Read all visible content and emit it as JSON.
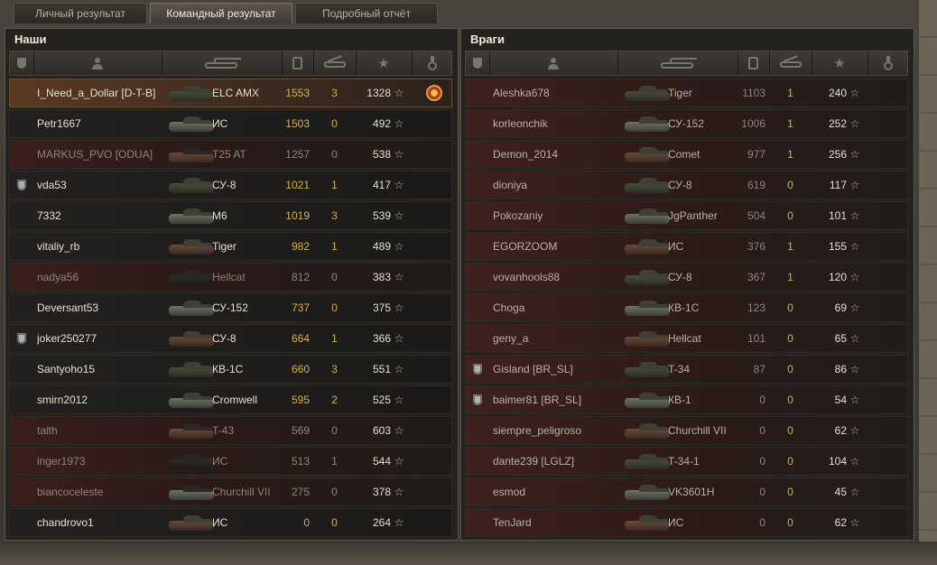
{
  "tabs": [
    {
      "label": "Личный результат",
      "active": false
    },
    {
      "label": "Командный результат",
      "active": true
    },
    {
      "label": "Подробный отчёт",
      "active": false
    }
  ],
  "ours": {
    "title": "Наши",
    "header_icons": [
      "shield-icon",
      "person-icon",
      "tank-icon",
      "hp-icon",
      "destroyed-icon",
      "star-icon",
      "medal-icon"
    ],
    "rows": [
      {
        "badge": false,
        "name": "I_Need_a_Dollar [D-T-B]",
        "tank": "ELC AMX",
        "damage": "1553",
        "kills": "3",
        "xp": "1328",
        "star": "☆",
        "medal": true,
        "alive": true,
        "self": true
      },
      {
        "badge": false,
        "name": "Petr1667",
        "tank": "ИС",
        "damage": "1503",
        "kills": "0",
        "xp": "492",
        "star": "☆",
        "medal": false,
        "alive": true
      },
      {
        "badge": false,
        "name": "MARKUS_PVO [ODUA]",
        "tank": "T25 AT",
        "damage": "1257",
        "kills": "0",
        "xp": "538",
        "star": "☆",
        "medal": false,
        "alive": false
      },
      {
        "badge": true,
        "name": "vda53",
        "tank": "СУ-8",
        "damage": "1021",
        "kills": "1",
        "xp": "417",
        "star": "☆",
        "medal": false,
        "alive": true
      },
      {
        "badge": false,
        "name": "7332",
        "tank": "M6",
        "damage": "1019",
        "kills": "3",
        "xp": "539",
        "star": "☆",
        "medal": false,
        "alive": true
      },
      {
        "badge": false,
        "name": "vitaliy_rb",
        "tank": "Tiger",
        "damage": "982",
        "kills": "1",
        "xp": "489",
        "star": "☆",
        "medal": false,
        "alive": true
      },
      {
        "badge": false,
        "name": "nadya56",
        "tank": "Hellcat",
        "damage": "812",
        "kills": "0",
        "xp": "383",
        "star": "☆",
        "medal": false,
        "alive": false
      },
      {
        "badge": false,
        "name": "Deversant53",
        "tank": "СУ-152",
        "damage": "737",
        "kills": "0",
        "xp": "375",
        "star": "☆",
        "medal": false,
        "alive": true
      },
      {
        "badge": true,
        "name": "joker250277",
        "tank": "СУ-8",
        "damage": "664",
        "kills": "1",
        "xp": "366",
        "star": "☆",
        "medal": false,
        "alive": true
      },
      {
        "badge": false,
        "name": "Santyoho15",
        "tank": "КВ-1С",
        "damage": "660",
        "kills": "3",
        "xp": "551",
        "star": "☆",
        "medal": false,
        "alive": true
      },
      {
        "badge": false,
        "name": "smirn2012",
        "tank": "Cromwell",
        "damage": "595",
        "kills": "2",
        "xp": "525",
        "star": "☆",
        "medal": false,
        "alive": true
      },
      {
        "badge": false,
        "name": "taith",
        "tank": "T-43",
        "damage": "569",
        "kills": "0",
        "xp": "603",
        "star": "☆",
        "medal": false,
        "alive": false
      },
      {
        "badge": false,
        "name": "inger1973",
        "tank": "ИС",
        "damage": "513",
        "kills": "1",
        "xp": "544",
        "star": "☆",
        "medal": false,
        "alive": false
      },
      {
        "badge": false,
        "name": "biancoceleste",
        "tank": "Churchill VII",
        "damage": "275",
        "kills": "0",
        "xp": "378",
        "star": "☆",
        "medal": false,
        "alive": false
      },
      {
        "badge": false,
        "name": "chandrovo1",
        "tank": "ИС",
        "damage": "0",
        "kills": "0",
        "xp": "264",
        "star": "☆",
        "medal": false,
        "alive": true
      }
    ]
  },
  "enemies": {
    "title": "Враги",
    "header_icons": [
      "shield-icon",
      "person-icon",
      "tank-icon",
      "hp-icon",
      "destroyed-icon",
      "star-icon",
      "medal-icon"
    ],
    "rows": [
      {
        "badge": false,
        "name": "Aleshka678",
        "tank": "Tiger",
        "damage": "1103",
        "kills": "1",
        "xp": "240",
        "star": "☆"
      },
      {
        "badge": false,
        "name": "korleonchik",
        "tank": "СУ-152",
        "damage": "1006",
        "kills": "1",
        "xp": "252",
        "star": "☆"
      },
      {
        "badge": false,
        "name": "Demon_2014",
        "tank": "Comet",
        "damage": "977",
        "kills": "1",
        "xp": "256",
        "star": "☆"
      },
      {
        "badge": false,
        "name": "dioniya",
        "tank": "СУ-8",
        "damage": "619",
        "kills": "0",
        "xp": "117",
        "star": "☆"
      },
      {
        "badge": false,
        "name": "Pokozaniy",
        "tank": "JgPanther",
        "damage": "504",
        "kills": "0",
        "xp": "101",
        "star": "☆"
      },
      {
        "badge": false,
        "name": "EGORZOOM",
        "tank": "ИС",
        "damage": "376",
        "kills": "1",
        "xp": "155",
        "star": "☆"
      },
      {
        "badge": false,
        "name": "vovanhools88",
        "tank": "СУ-8",
        "damage": "367",
        "kills": "1",
        "xp": "120",
        "star": "☆"
      },
      {
        "badge": false,
        "name": "Choga",
        "tank": "КВ-1С",
        "damage": "123",
        "kills": "0",
        "xp": "69",
        "star": "☆"
      },
      {
        "badge": false,
        "name": "geny_a",
        "tank": "Hellcat",
        "damage": "101",
        "kills": "0",
        "xp": "65",
        "star": "☆"
      },
      {
        "badge": true,
        "name": "Gisland [BR_SL]",
        "tank": "T-34",
        "damage": "87",
        "kills": "0",
        "xp": "86",
        "star": "☆"
      },
      {
        "badge": true,
        "name": "baimer81 [BR_SL]",
        "tank": "КВ-1",
        "damage": "0",
        "kills": "0",
        "xp": "54",
        "star": "☆"
      },
      {
        "badge": false,
        "name": "siempre_peligroso",
        "tank": "Churchill VII",
        "damage": "0",
        "kills": "0",
        "xp": "62",
        "star": "☆"
      },
      {
        "badge": false,
        "name": "dante239 [LGLZ]",
        "tank": "T-34-1",
        "damage": "0",
        "kills": "0",
        "xp": "104",
        "star": "☆"
      },
      {
        "badge": false,
        "name": "esmod",
        "tank": "VK3601H",
        "damage": "0",
        "kills": "0",
        "xp": "45",
        "star": "☆"
      },
      {
        "badge": false,
        "name": "TenJard",
        "tank": "ИС",
        "damage": "0",
        "kills": "0",
        "xp": "62",
        "star": "☆"
      }
    ]
  },
  "colors": {
    "accent_gold": "#d5b04a",
    "dead_row": "#3a1f1c",
    "self_row": "#5a3a22"
  }
}
